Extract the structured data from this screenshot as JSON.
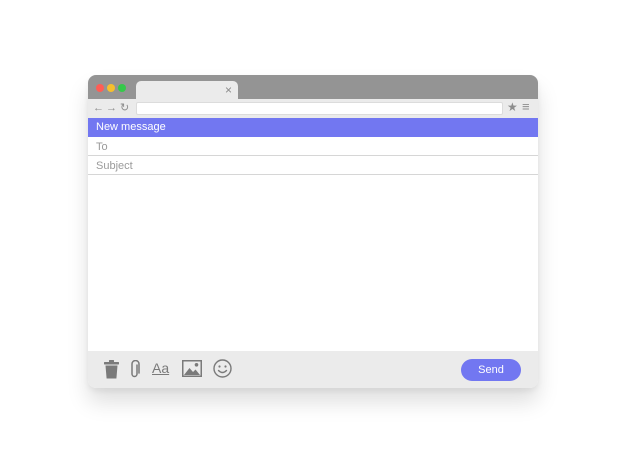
{
  "browser": {
    "tab_close_glyph": "×",
    "nav": {
      "back_glyph": "←",
      "forward_glyph": "→",
      "reload_glyph": "↻",
      "bookmark_glyph": "★",
      "menu_glyph": "≡"
    }
  },
  "compose": {
    "header_title": "New message",
    "to_placeholder": "To",
    "subject_placeholder": "Subject",
    "toolbar": {
      "format_label": "Aa",
      "icons": [
        "trash-icon",
        "paperclip-icon",
        "text-format-icon",
        "image-icon",
        "emoji-icon"
      ]
    },
    "send_label": "Send"
  },
  "colors": {
    "accent": "#7277f1",
    "titlebar": "#949494",
    "chrome": "#ebebeb",
    "close_dot": "#ff5d55",
    "minimize_dot": "#f6bf2e",
    "maximize_dot": "#35c94a"
  }
}
